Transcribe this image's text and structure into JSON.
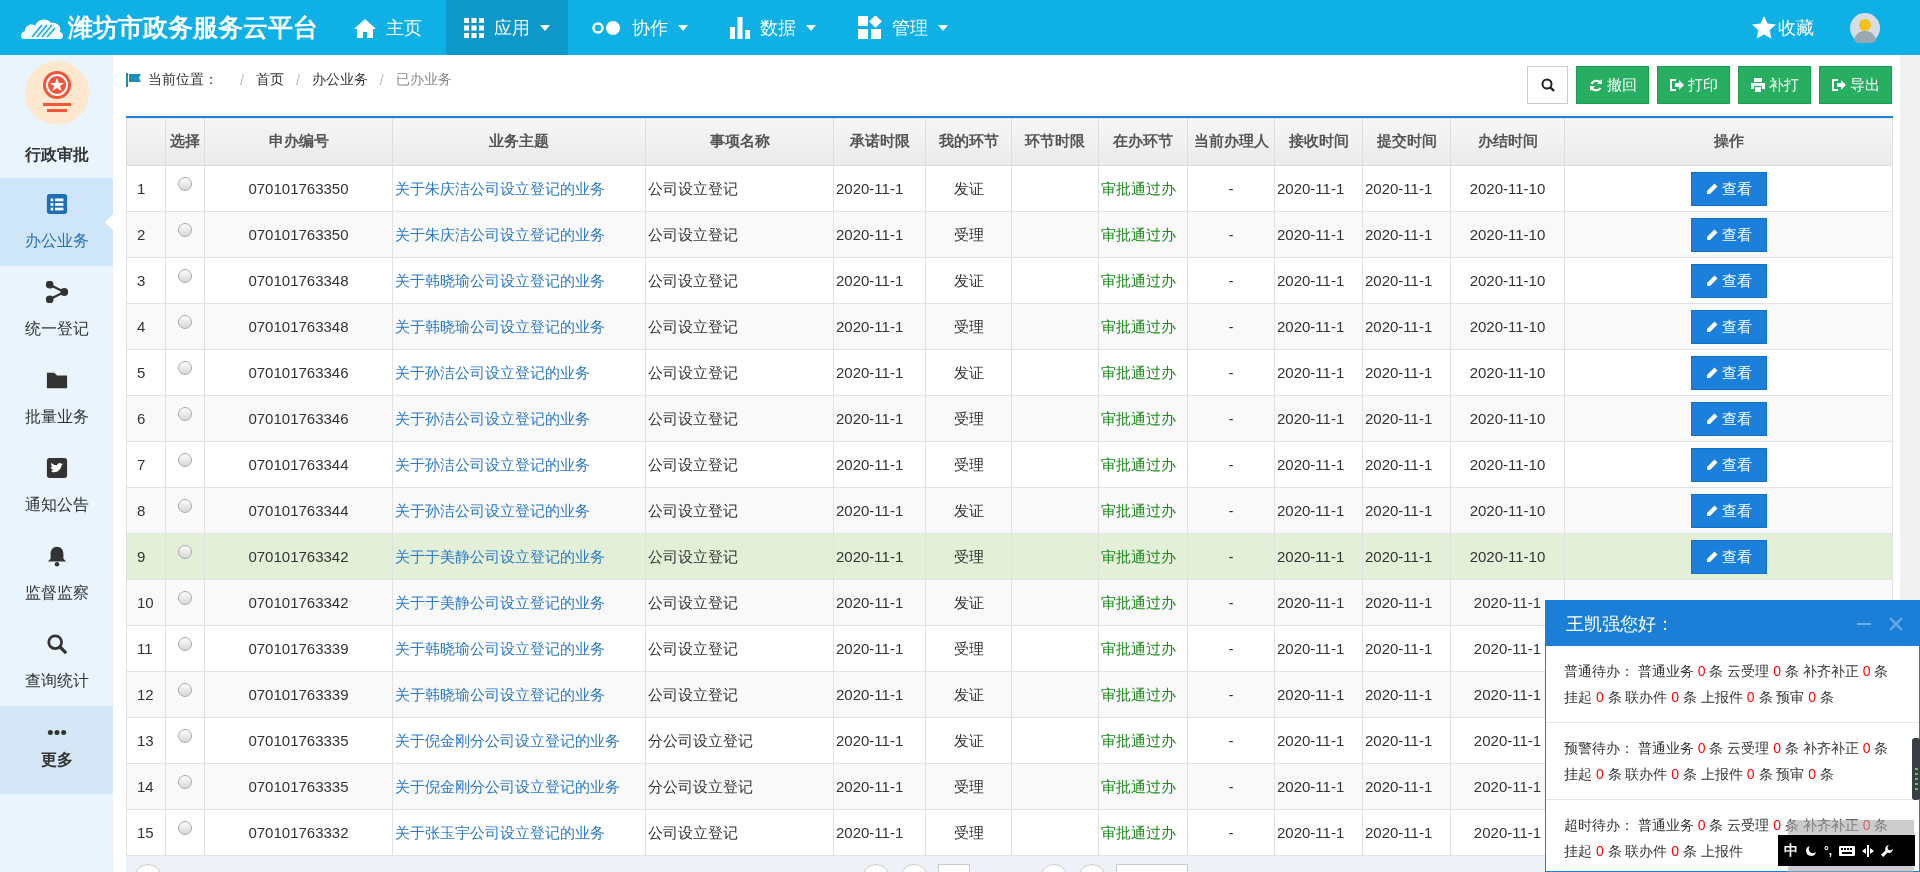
{
  "header": {
    "title": "潍坊市政务服务云平台",
    "nav": [
      {
        "label": "主页",
        "selected": false,
        "dropdown": false
      },
      {
        "label": "应用",
        "selected": true,
        "dropdown": true
      },
      {
        "label": "协作",
        "selected": false,
        "dropdown": true
      },
      {
        "label": "数据",
        "selected": false,
        "dropdown": true
      },
      {
        "label": "管理",
        "selected": false,
        "dropdown": true
      }
    ],
    "favorites": "收藏"
  },
  "sidebar": {
    "title": "行政审批",
    "items": [
      {
        "label": "办公业务",
        "kind": "link",
        "selected": true
      },
      {
        "label": "统一登记",
        "kind": "link",
        "selected": false
      },
      {
        "label": "批量业务",
        "kind": "link",
        "selected": false
      },
      {
        "label": "通知公告",
        "kind": "link",
        "selected": false
      },
      {
        "label": "监督监察",
        "kind": "link",
        "selected": false
      },
      {
        "label": "查询统计",
        "kind": "link",
        "selected": false
      },
      {
        "label": "更多",
        "kind": "more",
        "selected": false
      }
    ]
  },
  "breadcrumb": {
    "label": "当前位置：",
    "items": [
      {
        "sep": "/",
        "label": "首页",
        "current": false
      },
      {
        "sep": "/",
        "label": "办公业务",
        "current": false
      },
      {
        "sep": "/",
        "label": "已办业务",
        "current": true
      }
    ]
  },
  "toolbar": [
    "撤回",
    "打印",
    "补打",
    "导出"
  ],
  "table": {
    "columns": [
      "选择",
      "申办编号",
      "业务主题",
      "事项名称",
      "承诺时限",
      "我的环节",
      "环节时限",
      "在办环节",
      "当前办理人",
      "接收时间",
      "提交时间",
      "办结时间",
      "操作"
    ],
    "rows": [
      {
        "no": "1",
        "checked": false,
        "highlighted": false,
        "id": "070101763350",
        "subject": "关于朱庆洁公司设立登记的业务",
        "item": "公司设立登记",
        "deadline": "2020-11-1",
        "my_step": "发证",
        "current_step": "审批通过办",
        "handler": "-",
        "received": "2020-11-1",
        "submitted": "2020-11-1",
        "completed": "2020-11-10",
        "action": "查看"
      },
      {
        "no": "2",
        "checked": false,
        "highlighted": false,
        "id": "070101763350",
        "subject": "关于朱庆洁公司设立登记的业务",
        "item": "公司设立登记",
        "deadline": "2020-11-1",
        "my_step": "受理",
        "current_step": "审批通过办",
        "handler": "-",
        "received": "2020-11-1",
        "submitted": "2020-11-1",
        "completed": "2020-11-10",
        "action": "查看"
      },
      {
        "no": "3",
        "checked": false,
        "highlighted": false,
        "id": "070101763348",
        "subject": "关于韩晓瑜公司设立登记的业务",
        "item": "公司设立登记",
        "deadline": "2020-11-1",
        "my_step": "发证",
        "current_step": "审批通过办",
        "handler": "-",
        "received": "2020-11-1",
        "submitted": "2020-11-1",
        "completed": "2020-11-10",
        "action": "查看"
      },
      {
        "no": "4",
        "checked": false,
        "highlighted": false,
        "id": "070101763348",
        "subject": "关于韩晓瑜公司设立登记的业务",
        "item": "公司设立登记",
        "deadline": "2020-11-1",
        "my_step": "受理",
        "current_step": "审批通过办",
        "handler": "-",
        "received": "2020-11-1",
        "submitted": "2020-11-1",
        "completed": "2020-11-10",
        "action": "查看"
      },
      {
        "no": "5",
        "checked": false,
        "highlighted": false,
        "id": "070101763346",
        "subject": "关于孙洁公司设立登记的业务",
        "item": "公司设立登记",
        "deadline": "2020-11-1",
        "my_step": "发证",
        "current_step": "审批通过办",
        "handler": "-",
        "received": "2020-11-1",
        "submitted": "2020-11-1",
        "completed": "2020-11-10",
        "action": "查看"
      },
      {
        "no": "6",
        "checked": false,
        "highlighted": false,
        "id": "070101763346",
        "subject": "关于孙洁公司设立登记的业务",
        "item": "公司设立登记",
        "deadline": "2020-11-1",
        "my_step": "受理",
        "current_step": "审批通过办",
        "handler": "-",
        "received": "2020-11-1",
        "submitted": "2020-11-1",
        "completed": "2020-11-10",
        "action": "查看"
      },
      {
        "no": "7",
        "checked": false,
        "highlighted": false,
        "id": "070101763344",
        "subject": "关于孙洁公司设立登记的业务",
        "item": "公司设立登记",
        "deadline": "2020-11-1",
        "my_step": "受理",
        "current_step": "审批通过办",
        "handler": "-",
        "received": "2020-11-1",
        "submitted": "2020-11-1",
        "completed": "2020-11-10",
        "action": "查看"
      },
      {
        "no": "8",
        "checked": false,
        "highlighted": false,
        "id": "070101763344",
        "subject": "关于孙洁公司设立登记的业务",
        "item": "公司设立登记",
        "deadline": "2020-11-1",
        "my_step": "发证",
        "current_step": "审批通过办",
        "handler": "-",
        "received": "2020-11-1",
        "submitted": "2020-11-1",
        "completed": "2020-11-10",
        "action": "查看"
      },
      {
        "no": "9",
        "checked": false,
        "highlighted": true,
        "id": "070101763342",
        "subject": "关于于美静公司设立登记的业务",
        "item": "公司设立登记",
        "deadline": "2020-11-1",
        "my_step": "受理",
        "current_step": "审批通过办",
        "handler": "-",
        "received": "2020-11-1",
        "submitted": "2020-11-1",
        "completed": "2020-11-10",
        "action": "查看"
      },
      {
        "no": "10",
        "checked": false,
        "highlighted": false,
        "id": "070101763342",
        "subject": "关于于美静公司设立登记的业务",
        "item": "公司设立登记",
        "deadline": "2020-11-1",
        "my_step": "发证",
        "current_step": "审批通过办",
        "handler": "-",
        "received": "2020-11-1",
        "submitted": "2020-11-1",
        "completed": "2020-11-1"
      },
      {
        "no": "11",
        "checked": false,
        "highlighted": false,
        "id": "070101763339",
        "subject": "关于韩晓瑜公司设立登记的业务",
        "item": "公司设立登记",
        "deadline": "2020-11-1",
        "my_step": "受理",
        "current_step": "审批通过办",
        "handler": "-",
        "received": "2020-11-1",
        "submitted": "2020-11-1",
        "completed": "2020-11-1"
      },
      {
        "no": "12",
        "checked": false,
        "highlighted": false,
        "id": "070101763339",
        "subject": "关于韩晓瑜公司设立登记的业务",
        "item": "公司设立登记",
        "deadline": "2020-11-1",
        "my_step": "发证",
        "current_step": "审批通过办",
        "handler": "-",
        "received": "2020-11-1",
        "submitted": "2020-11-1",
        "completed": "2020-11-1"
      },
      {
        "no": "13",
        "checked": false,
        "highlighted": false,
        "id": "070101763335",
        "subject": "关于倪金刚分公司设立登记的业务",
        "item": "分公司设立登记",
        "deadline": "2020-11-1",
        "my_step": "发证",
        "current_step": "审批通过办",
        "handler": "-",
        "received": "2020-11-1",
        "submitted": "2020-11-1",
        "completed": "2020-11-1"
      },
      {
        "no": "14",
        "checked": false,
        "highlighted": false,
        "id": "070101763335",
        "subject": "关于倪金刚分公司设立登记的业务",
        "item": "分公司设立登记",
        "deadline": "2020-11-1",
        "my_step": "受理",
        "current_step": "审批通过办",
        "handler": "-",
        "received": "2020-11-1",
        "submitted": "2020-11-1",
        "completed": "2020-11-1"
      },
      {
        "no": "15",
        "checked": false,
        "highlighted": false,
        "id": "070101763332",
        "subject": "关于张玉宇公司设立登记的业务",
        "item": "公司设立登记",
        "deadline": "2020-11-1",
        "my_step": "受理",
        "current_step": "审批通过办",
        "handler": "-",
        "received": "2020-11-1",
        "submitted": "2020-11-1",
        "completed": "2020-11-1"
      }
    ]
  },
  "popup": {
    "title": "王凯强您好：",
    "sections": [
      {
        "label": "普通待办：",
        "items": [
          {
            "name": "普通业务",
            "count": "0",
            "unit": "条"
          },
          {
            "name": "云受理",
            "count": "0",
            "unit": "条"
          },
          {
            "name": "补齐补正",
            "count": "0",
            "unit": "条"
          },
          {
            "name": "挂起",
            "count": "0",
            "unit": "条"
          },
          {
            "name": "联办件",
            "count": "0",
            "unit": "条"
          },
          {
            "name": "上报件",
            "count": "0",
            "unit": "条"
          },
          {
            "name": "预审",
            "count": "0",
            "unit": "条"
          }
        ]
      },
      {
        "label": "预警待办：",
        "items": [
          {
            "name": "普通业务",
            "count": "0",
            "unit": "条"
          },
          {
            "name": "云受理",
            "count": "0",
            "unit": "条"
          },
          {
            "name": "补齐补正",
            "count": "0",
            "unit": "条"
          },
          {
            "name": "挂起",
            "count": "0",
            "unit": "条"
          },
          {
            "name": "联办件",
            "count": "0",
            "unit": "条"
          },
          {
            "name": "上报件",
            "count": "0",
            "unit": "条"
          },
          {
            "name": "预审",
            "count": "0",
            "unit": "条"
          }
        ]
      },
      {
        "label": "超时待办：",
        "items": [
          {
            "name": "普通业务",
            "count": "0",
            "unit": "条"
          },
          {
            "name": "云受理",
            "count": "0",
            "unit": "条"
          },
          {
            "name": "补齐补正",
            "count": "0",
            "unit": "条"
          },
          {
            "name": "挂起",
            "count": "0",
            "unit": "条"
          },
          {
            "name": "联办件",
            "count": "0",
            "unit": "条"
          },
          {
            "name": "上报件"
          }
        ]
      }
    ]
  },
  "ime": {
    "label": "中",
    "punct": "°,"
  }
}
